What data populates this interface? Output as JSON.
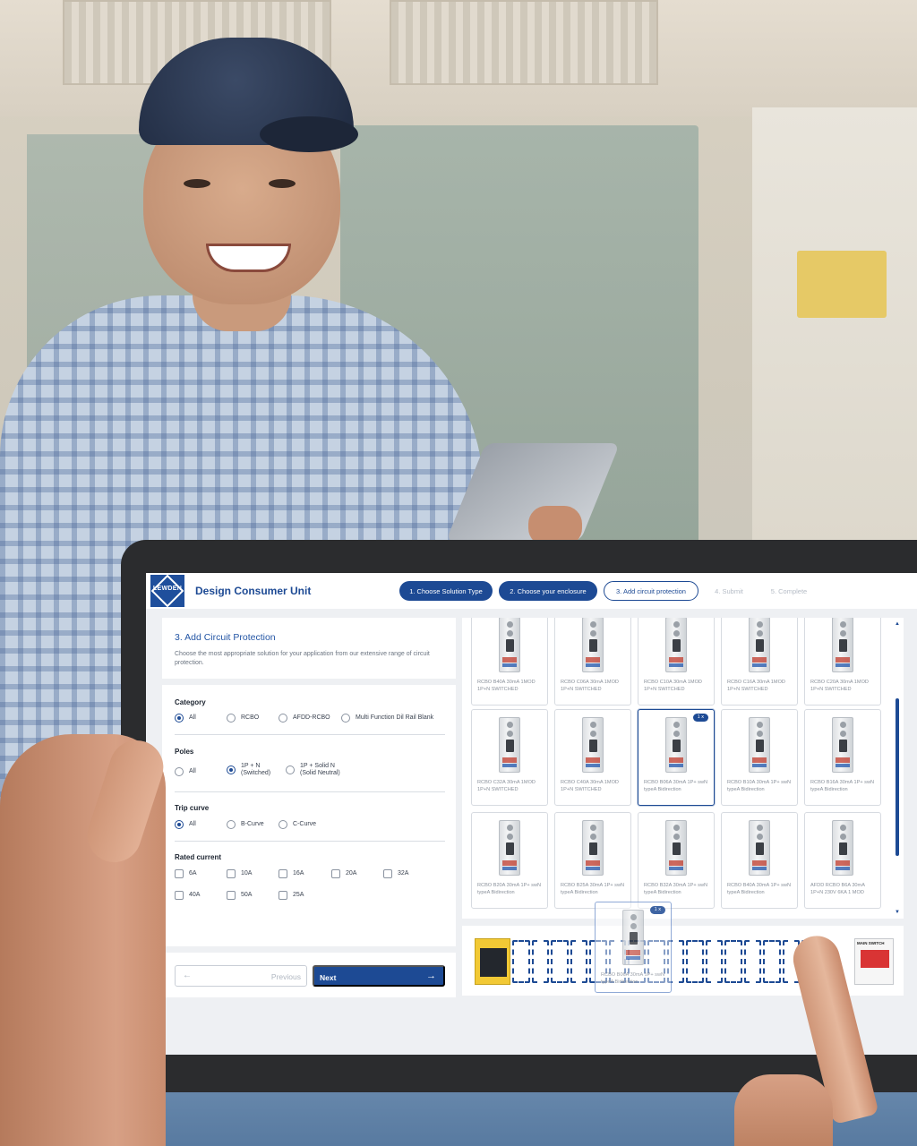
{
  "app": {
    "logo_text": "LEWDEN",
    "title": "Design Consumer Unit"
  },
  "steps": [
    {
      "label": "1. Choose Solution Type",
      "state": "done"
    },
    {
      "label": "2. Choose your enclosure",
      "state": "done"
    },
    {
      "label": "3. Add circuit protection",
      "state": "current"
    },
    {
      "label": "4. Submit",
      "state": "todo"
    },
    {
      "label": "5. Complete",
      "state": "todo"
    }
  ],
  "panel": {
    "title": "3. Add Circuit Protection",
    "description": "Choose the most appropriate solution for your application from our extensive range of circuit protection."
  },
  "filters": {
    "category": {
      "label": "Category",
      "options": [
        "All",
        "RCBO",
        "AFDD-RCBO",
        "Multi Function Dil Rail Blank"
      ],
      "selected": "All"
    },
    "poles": {
      "label": "Poles",
      "options": [
        {
          "line1": "All",
          "line2": ""
        },
        {
          "line1": "1P + N",
          "line2": "(Switched)"
        },
        {
          "line1": "1P + Solid N",
          "line2": "(Solid Neutral)"
        }
      ],
      "selected": "1P + N"
    },
    "trip_curve": {
      "label": "Trip curve",
      "options": [
        "All",
        "B-Curve",
        "C-Curve"
      ],
      "selected": "All"
    },
    "rated_current": {
      "label": "Rated current",
      "options": [
        "6A",
        "10A",
        "16A",
        "20A",
        "32A",
        "40A",
        "50A",
        "25A"
      ]
    }
  },
  "buttons": {
    "previous": "Previous",
    "next": "Next"
  },
  "products": [
    {
      "name": "RCBO B40A 30mA 1MOD 1P+N SWITCHED",
      "qty": ""
    },
    {
      "name": "RCBO C06A 30mA 1MOD 1P+N SWITCHED",
      "qty": ""
    },
    {
      "name": "RCBO C10A 30mA 1MOD 1P+N SWITCHED",
      "qty": ""
    },
    {
      "name": "RCBO C16A 30mA 1MOD 1P+N SWITCHED",
      "qty": ""
    },
    {
      "name": "RCBO C20A 30mA 1MOD 1P+N SWITCHED",
      "qty": ""
    },
    {
      "name": "RCBO C32A 30mA 1MOD 1P+N SWITCHED",
      "qty": ""
    },
    {
      "name": "RCBO C40A 30mA 1MOD 1P+N SWITCHED",
      "qty": ""
    },
    {
      "name": "RCBO B06A 30mA 1P+ swN typeA Bidirection",
      "qty": "1 x"
    },
    {
      "name": "RCBO B10A 30mA 1P+ swN typeA Bidirection",
      "qty": ""
    },
    {
      "name": "RCBO B16A 30mA 1P+ swN typeA Bidirection",
      "qty": ""
    },
    {
      "name": "RCBO B20A 30mA 1P+ swN typeA Bidirection",
      "qty": ""
    },
    {
      "name": "RCBO B25A 30mA 1P+ swN typeA Bidirection",
      "qty": ""
    },
    {
      "name": "RCBO B32A 30mA 1P+ swN typeA Bidirection",
      "qty": ""
    },
    {
      "name": "RCBO B40A 30mA 1P+ swN typeA Bidirection",
      "qty": ""
    },
    {
      "name": "AFDD RCBO B6A 30mA 1P+N 230V 6KA 1 MOD",
      "qty": ""
    }
  ],
  "drag_item": {
    "name": "RCBO B06A 30mA 1P+ swN typeA Bidirection",
    "qty": "1 x"
  },
  "enclosure": {
    "switch_label": "MAIN SWITCH",
    "empty_slots": 16
  }
}
